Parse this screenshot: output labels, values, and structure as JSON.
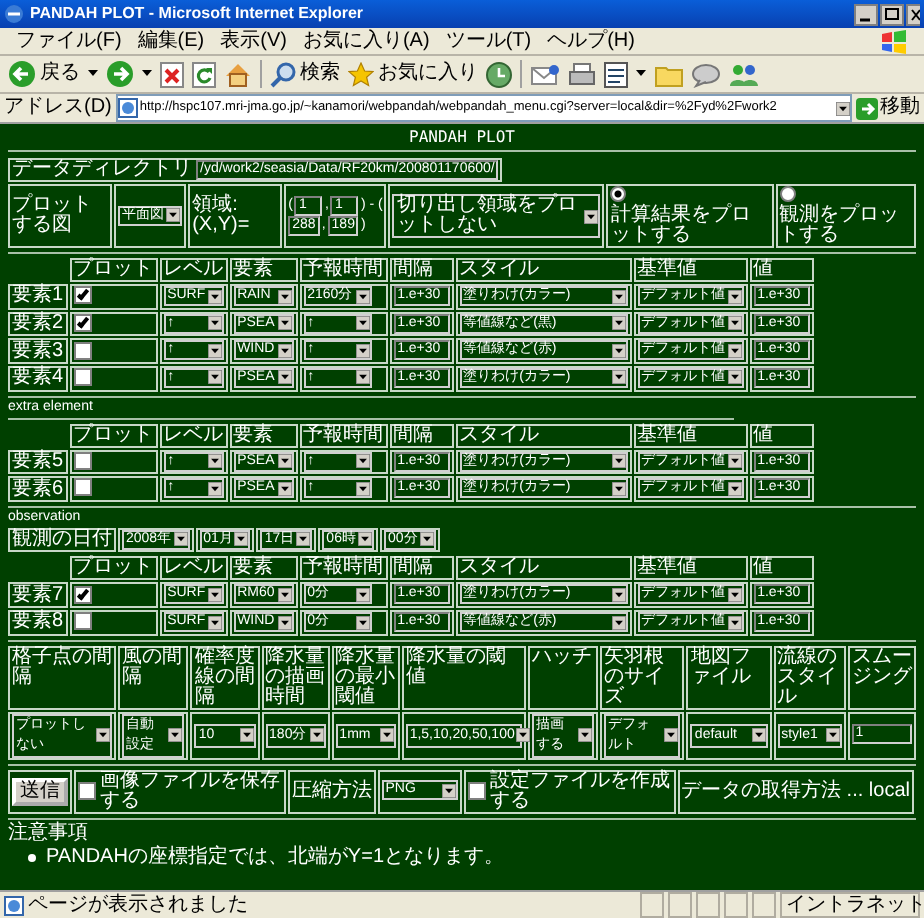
{
  "window": {
    "title": "PANDAH PLOT - Microsoft Internet Explorer"
  },
  "menu": [
    "ファイル(F)",
    "編集(E)",
    "表示(V)",
    "お気に入り(A)",
    "ツール(T)",
    "ヘルプ(H)"
  ],
  "toolbar": {
    "back": "戻る",
    "search": "検索",
    "favorites": "お気に入り"
  },
  "address": {
    "label": "アドレス(D)",
    "url": "http://hspc107.mri-jma.go.jp/~kanamori/webpandah/webpandah_menu.cgi?server=local&dir=%2Fyd%2Fwork2",
    "go": "移動"
  },
  "page": {
    "heading": "PANDAH PLOT",
    "data_directory": {
      "label": "データディレクトリ",
      "value": "/yd/work2/seasia/Data/RF20km/200801170600/"
    },
    "plot_options": {
      "figure_label": "プロットする図",
      "figure": "平面図",
      "region_label": "領域:(X,Y)=",
      "region_parts": [
        {
          "kind": "text",
          "text": "("
        },
        {
          "kind": "input",
          "text": "1"
        },
        {
          "kind": "text",
          "text": ","
        },
        {
          "kind": "input",
          "text": "1"
        },
        {
          "kind": "text",
          "text": ") - ("
        },
        {
          "kind": "break"
        },
        {
          "kind": "input",
          "text": "288"
        },
        {
          "kind": "text",
          "text": ","
        },
        {
          "kind": "input",
          "text": "189"
        },
        {
          "kind": "text",
          "text": ")"
        }
      ],
      "crop": "切り出し領域をプロットしない",
      "sources": [
        {
          "label": "計算結果をプロットする",
          "selected": true
        },
        {
          "label": "観測をプロットする",
          "selected": false
        }
      ]
    },
    "sections": [
      {
        "columns": [
          "プロット",
          "レベル",
          "要素",
          "予報時間",
          "間隔",
          "スタイル",
          "基準値",
          "値"
        ],
        "rows": [
          {
            "name": "要素1",
            "checked": true,
            "vertical": "SURF",
            "element": "RAIN",
            "forecast": "2160分",
            "interval": "1.e+30",
            "style": "塗りわけ(カラー)",
            "reference": "デフォルト値",
            "value": "1.e+30"
          },
          {
            "name": "要素2",
            "checked": true,
            "vertical": "↑",
            "element": "PSEA",
            "forecast": "↑",
            "interval": "1.e+30",
            "style": "等値線など(黒)",
            "reference": "デフォルト値",
            "value": "1.e+30"
          },
          {
            "name": "要素3",
            "checked": false,
            "vertical": "↑",
            "element": "WIND",
            "forecast": "↑",
            "interval": "1.e+30",
            "style": "等値線など(赤)",
            "reference": "デフォルト値",
            "value": "1.e+30"
          },
          {
            "name": "要素4",
            "checked": false,
            "vertical": "↑",
            "element": "PSEA",
            "forecast": "↑",
            "interval": "1.e+30",
            "style": "塗りわけ(カラー)",
            "reference": "デフォルト値",
            "value": "1.e+30"
          }
        ]
      },
      {
        "title": "extra element",
        "columns": [
          "プロット",
          "レベル",
          "要素",
          "予報時間",
          "間隔",
          "スタイル",
          "基準値",
          "値"
        ],
        "rows": [
          {
            "name": "要素5",
            "checked": false,
            "vertical": "↑",
            "element": "PSEA",
            "forecast": "↑",
            "interval": "1.e+30",
            "style": "塗りわけ(カラー)",
            "reference": "デフォルト値",
            "value": "1.e+30"
          },
          {
            "name": "要素6",
            "checked": false,
            "vertical": "↑",
            "element": "PSEA",
            "forecast": "↑",
            "interval": "1.e+30",
            "style": "塗りわけ(カラー)",
            "reference": "デフォルト値",
            "value": "1.e+30"
          }
        ]
      },
      {
        "title": "observation",
        "date": {
          "label": "観測の日付",
          "parts": [
            "2008年",
            "01月",
            "17日",
            "06時",
            "00分"
          ]
        },
        "columns": [
          "プロット",
          "レベル",
          "要素",
          "予報時間",
          "間隔",
          "スタイル",
          "基準値",
          "値"
        ],
        "rows": [
          {
            "name": "要素7",
            "checked": true,
            "vertical": "SURF",
            "element": "RM60",
            "forecast": "0分",
            "interval": "1.e+30",
            "style": "塗りわけ(カラー)",
            "reference": "デフォルト値",
            "value": "1.e+30"
          },
          {
            "name": "要素8",
            "checked": false,
            "vertical": "SURF",
            "element": "WIND",
            "forecast": "0分",
            "interval": "1.e+30",
            "style": "等値線など(赤)",
            "reference": "デフォルト値",
            "value": "1.e+30"
          }
        ]
      }
    ],
    "settings": {
      "columns": [
        "格子点の間隔",
        "風の間隔",
        "確率度線の間隔",
        "降水量の描画時間",
        "降水量の最小閾値",
        "降水量の閾値",
        "ハッチ",
        "矢羽根のサイズ",
        "地図ファイル",
        "流線のスタイル",
        "スムージング"
      ],
      "values": [
        {
          "kind": "select",
          "text": "プロットしない"
        },
        {
          "kind": "select",
          "text": "自動設定"
        },
        {
          "kind": "select",
          "text": "10"
        },
        {
          "kind": "select",
          "text": "180分"
        },
        {
          "kind": "select",
          "text": "1mm"
        },
        {
          "kind": "select",
          "text": "1,5,10,20,50,100"
        },
        {
          "kind": "select",
          "text": "描画する"
        },
        {
          "kind": "select",
          "text": "デフォルト"
        },
        {
          "kind": "select",
          "text": "default"
        },
        {
          "kind": "select",
          "text": "style1"
        },
        {
          "kind": "input",
          "text": "1"
        }
      ]
    },
    "actions": {
      "submit": "送信",
      "save_image": {
        "label": "画像ファイルを保存する",
        "checked": false
      },
      "compression_label": "圧縮方法",
      "compression": "PNG",
      "make_config": {
        "label": "設定ファイルを作成する",
        "checked": false
      },
      "fetch_method": "データの取得方法 ... local"
    },
    "notes": {
      "title": "注意事項",
      "items": [
        "PANDAHの座標指定では、北端がY=1となります。"
      ]
    }
  },
  "status_bar": {
    "text": "ページが表示されました",
    "zone": "イントラネット"
  }
}
